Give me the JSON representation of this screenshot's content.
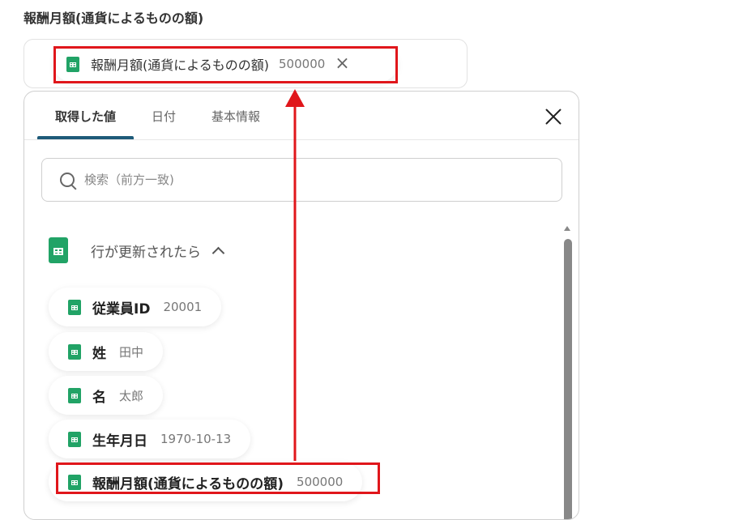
{
  "field": {
    "label": "報酬月額(通貨によるものの額)",
    "chip_label": "報酬月額(通貨によるものの額)",
    "chip_value": "500000"
  },
  "tabs": [
    {
      "label": "取得した値",
      "active": true
    },
    {
      "label": "日付",
      "active": false
    },
    {
      "label": "基本情報",
      "active": false
    }
  ],
  "search": {
    "placeholder": "検索（前方一致)"
  },
  "section": {
    "title": "行が更新されたら"
  },
  "items": [
    {
      "label": "従業員ID",
      "value": "20001"
    },
    {
      "label": "姓",
      "value": "田中"
    },
    {
      "label": "名",
      "value": "太郎"
    },
    {
      "label": "生年月日",
      "value": "1970-10-13"
    },
    {
      "label": "報酬月額(通貨によるものの額)",
      "value": "500000"
    }
  ],
  "colors": {
    "accent": "#1e5b79",
    "sheets_green": "#21a366",
    "annotation_red": "#e0161b"
  }
}
